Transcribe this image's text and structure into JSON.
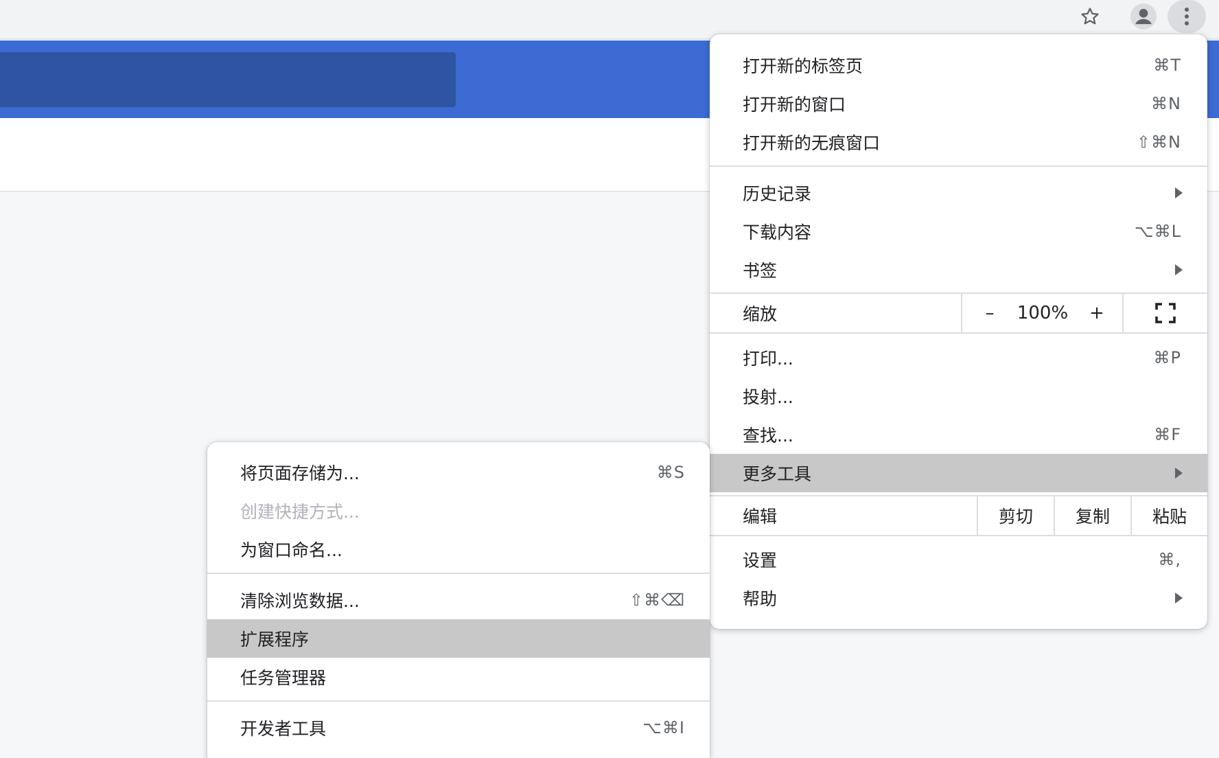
{
  "toolbar": {
    "star_icon": "star-outline-icon",
    "avatar_icon": "person-icon",
    "more_icon": "three-dot-vertical-icon"
  },
  "main_menu": {
    "new_tab": {
      "label": "打开新的标签页",
      "shortcut": "⌘T"
    },
    "new_window": {
      "label": "打开新的窗口",
      "shortcut": "⌘N"
    },
    "incognito": {
      "label": "打开新的无痕窗口",
      "shortcut": "⇧⌘N"
    },
    "history": {
      "label": "历史记录"
    },
    "downloads": {
      "label": "下载内容",
      "shortcut": "⌥⌘L"
    },
    "bookmarks": {
      "label": "书签"
    },
    "zoom": {
      "label": "缩放",
      "minus": "–",
      "value": "100%",
      "plus": "+"
    },
    "print": {
      "label": "打印...",
      "shortcut": "⌘P"
    },
    "cast": {
      "label": "投射..."
    },
    "find": {
      "label": "查找...",
      "shortcut": "⌘F"
    },
    "more_tools": {
      "label": "更多工具"
    },
    "edit": {
      "label": "编辑",
      "cut": "剪切",
      "copy": "复制",
      "paste": "粘贴"
    },
    "settings": {
      "label": "设置",
      "shortcut": "⌘,"
    },
    "help": {
      "label": "帮助"
    }
  },
  "sub_menu": {
    "save_page": {
      "label": "将页面存储为...",
      "shortcut": "⌘S"
    },
    "create_shortcut": {
      "label": "创建快捷方式..."
    },
    "name_window": {
      "label": "为窗口命名..."
    },
    "clear_data": {
      "label": "清除浏览数据...",
      "shortcut": "⇧⌘⌫"
    },
    "extensions": {
      "label": "扩展程序"
    },
    "task_manager": {
      "label": "任务管理器"
    },
    "dev_tools": {
      "label": "开发者工具",
      "shortcut": "⌥⌘I"
    }
  },
  "colors": {
    "accent_blue": "#3c6bd3",
    "dark_blue": "#2f54a3",
    "highlight": "#c8c8c8"
  }
}
